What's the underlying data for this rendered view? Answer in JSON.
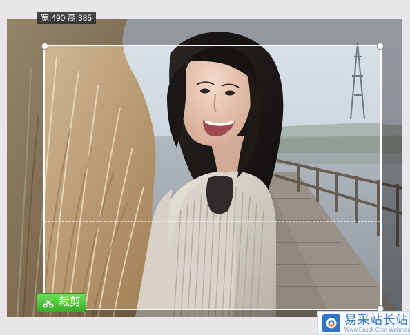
{
  "crop": {
    "dimensions": "宽:490 高:385",
    "button_label": "裁剪",
    "button_icon": "scissors-icon"
  },
  "watermark": {
    "main_text": "易采站长站",
    "sub_text": "Www.Easck.Com Webmaster",
    "logo_icon": "logo-icon"
  },
  "colors": {
    "crop_button": "#4caf50",
    "watermark_blue": "#2e72c9",
    "dimension_label_bg": "#2d2d2d"
  }
}
